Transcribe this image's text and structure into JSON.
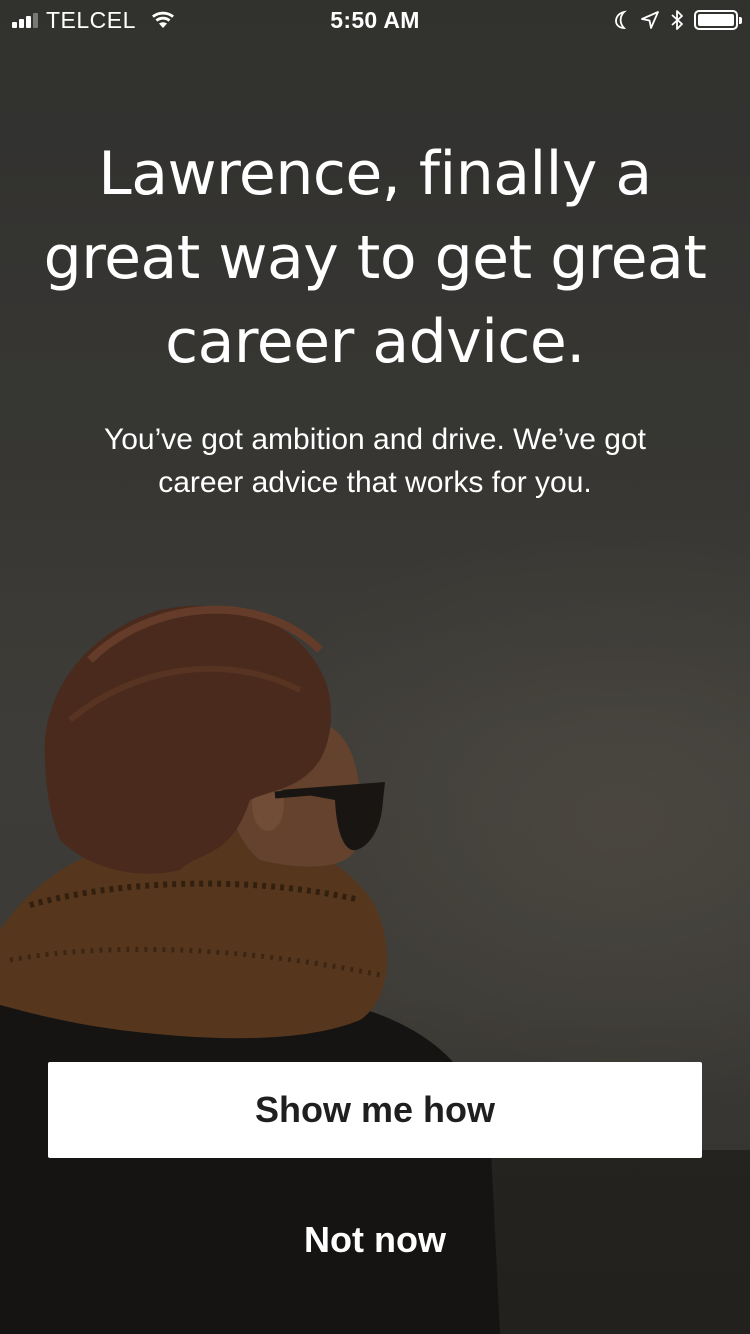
{
  "status_bar": {
    "carrier": "TELCEL",
    "time": "5:50 AM",
    "signal_bars": 4,
    "signal_bars_active": 3,
    "icons": [
      "wifi-icon",
      "moon-icon",
      "location-arrow-icon",
      "bluetooth-icon",
      "battery-icon"
    ],
    "battery_level": 1.0
  },
  "onboarding": {
    "headline": "Lawrence, finally a great way to get great career advice.",
    "subcopy": "You’ve got ambition and drive. We’ve got career advice that works for you.",
    "primary_button": "Show me how",
    "secondary_button": "Not now"
  },
  "colors": {
    "background": "#3c3c39",
    "text": "#ffffff",
    "primary_button_bg": "#ffffff",
    "primary_button_text": "#1f1f1f"
  }
}
